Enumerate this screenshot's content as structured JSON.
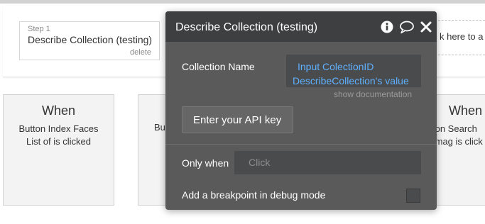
{
  "step": {
    "label": "Step 1",
    "title": "Describe Collection (testing)",
    "delete_label": "delete"
  },
  "click_here_text": "k here to a",
  "events": [
    {
      "title": "When",
      "line1": "Button Index Faces",
      "line2": "List of is clicked"
    },
    {
      "title": "",
      "line1": "Bu",
      "line2": ""
    },
    {
      "title": "When",
      "line1": "ton Search",
      "line2": "Imag is click"
    }
  ],
  "panel": {
    "title": "Describe Collection (testing)",
    "icons": [
      "info-icon",
      "comment-icon",
      "close-icon"
    ],
    "collection_name_label": "Collection Name",
    "collection_name_expr_line1": "Input ColectionID",
    "collection_name_expr_line2": "DescribeCollection's value",
    "show_documentation": "show documentation",
    "api_key_button": "Enter your API key",
    "only_when_label": "Only when",
    "only_when_placeholder": "Click",
    "breakpoint_label": "Add a breakpoint in debug mode"
  },
  "colors": {
    "panel_bg": "#5a5a5a",
    "panel_header": "#3e3f40",
    "expression_text": "#5fb0ff"
  }
}
